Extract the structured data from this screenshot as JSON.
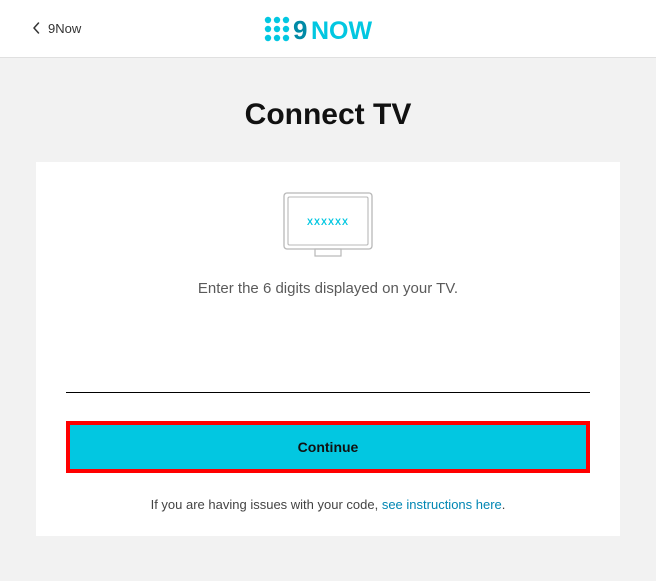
{
  "header": {
    "back_label": "9Now",
    "logo_text": "NOW"
  },
  "main": {
    "title": "Connect TV",
    "tv_placeholder": "XXXXXX",
    "instruction": "Enter the 6 digits displayed on your TV.",
    "code_value": "",
    "continue_label": "Continue",
    "help_prefix": "If you are having issues with your code, ",
    "help_link": "see instructions here",
    "help_suffix": "."
  },
  "colors": {
    "accent": "#02c7e1",
    "highlight_border": "#ff0000"
  }
}
